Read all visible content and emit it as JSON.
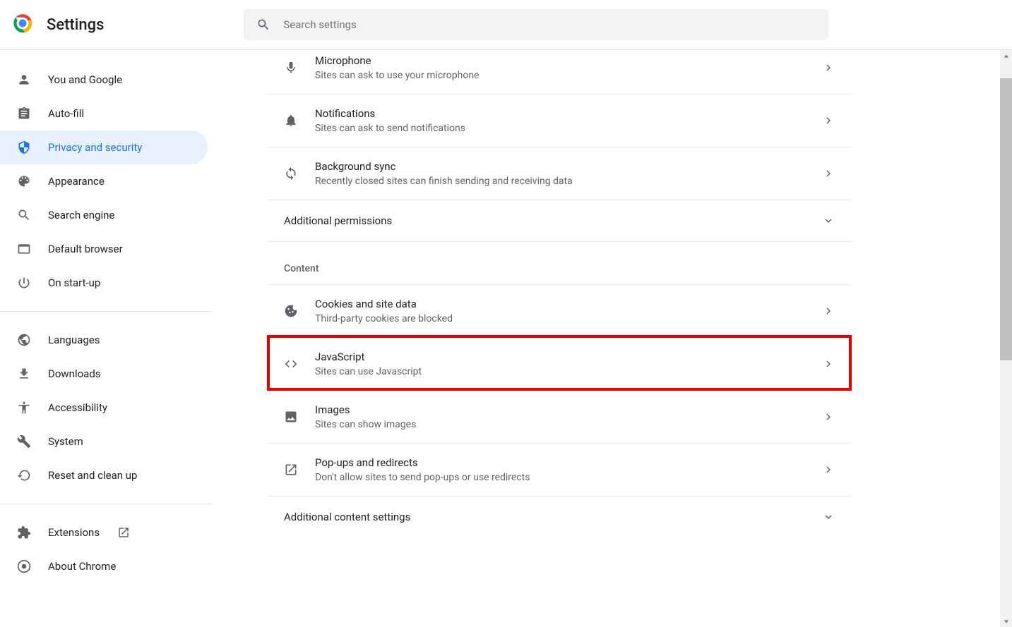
{
  "header": {
    "title": "Settings",
    "search_placeholder": "Search settings"
  },
  "sidebar": {
    "items": [
      {
        "icon": "person",
        "label": "You and Google"
      },
      {
        "icon": "clipboard",
        "label": "Auto-fill"
      },
      {
        "icon": "shield",
        "label": "Privacy and security",
        "active": true
      },
      {
        "icon": "palette",
        "label": "Appearance"
      },
      {
        "icon": "search",
        "label": "Search engine"
      },
      {
        "icon": "browser",
        "label": "Default browser"
      },
      {
        "icon": "power",
        "label": "On start-up"
      }
    ],
    "items2": [
      {
        "icon": "globe",
        "label": "Languages"
      },
      {
        "icon": "download",
        "label": "Downloads"
      },
      {
        "icon": "accessibility",
        "label": "Accessibility"
      },
      {
        "icon": "wrench",
        "label": "System"
      },
      {
        "icon": "restore",
        "label": "Reset and clean up"
      }
    ],
    "items3": [
      {
        "icon": "extension",
        "label": "Extensions",
        "external": true
      },
      {
        "icon": "chrome",
        "label": "About Chrome"
      }
    ]
  },
  "main": {
    "permissions": [
      {
        "icon": "mic",
        "title": "Microphone",
        "sub": "Sites can ask to use your microphone"
      },
      {
        "icon": "bell",
        "title": "Notifications",
        "sub": "Sites can ask to send notifications"
      },
      {
        "icon": "sync",
        "title": "Background sync",
        "sub": "Recently closed sites can finish sending and receiving data"
      }
    ],
    "additional_permissions": "Additional permissions",
    "content_header": "Content",
    "content": [
      {
        "icon": "cookie",
        "title": "Cookies and site data",
        "sub": "Third-party cookies are blocked"
      },
      {
        "icon": "code",
        "title": "JavaScript",
        "sub": "Sites can use Javascript",
        "highlighted": true
      },
      {
        "icon": "image",
        "title": "Images",
        "sub": "Sites can show images"
      },
      {
        "icon": "popup",
        "title": "Pop-ups and redirects",
        "sub": "Don't allow sites to send pop-ups or use redirects"
      }
    ],
    "additional_content": "Additional content settings"
  }
}
